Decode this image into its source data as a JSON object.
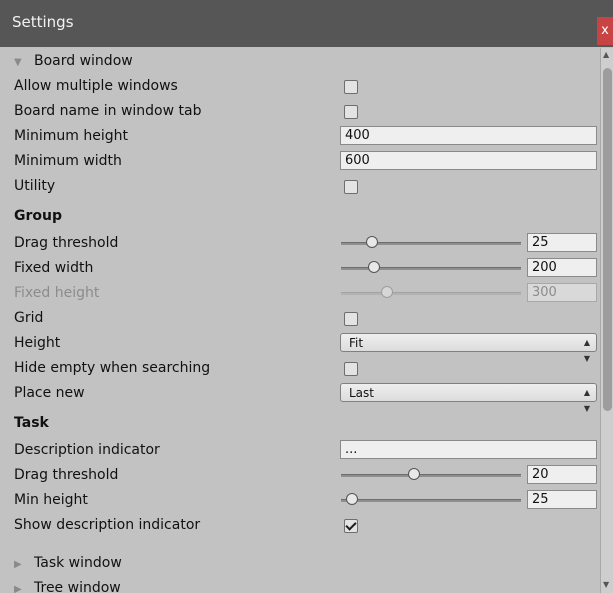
{
  "window": {
    "title": "Settings",
    "close_label": "x"
  },
  "board_window": {
    "label": "Board window",
    "allow_multiple_windows": {
      "label": "Allow multiple windows",
      "checked": false
    },
    "board_name_in_tab": {
      "label": "Board name in window tab",
      "checked": false
    },
    "minimum_height": {
      "label": "Minimum height",
      "value": "400"
    },
    "minimum_width": {
      "label": "Minimum width",
      "value": "600"
    },
    "utility": {
      "label": "Utility",
      "checked": false
    }
  },
  "group": {
    "header": "Group",
    "drag_threshold": {
      "label": "Drag threshold",
      "value": "25",
      "position": 0.15
    },
    "fixed_width": {
      "label": "Fixed width",
      "value": "200",
      "position": 0.16
    },
    "fixed_height": {
      "label": "Fixed height",
      "value": "300",
      "position": 0.24
    },
    "grid": {
      "label": "Grid",
      "checked": false
    },
    "height": {
      "label": "Height",
      "value": "Fit"
    },
    "hide_empty": {
      "label": "Hide empty when searching",
      "checked": false
    },
    "place_new": {
      "label": "Place new",
      "value": "Last"
    }
  },
  "task": {
    "header": "Task",
    "description_indicator": {
      "label": "Description indicator",
      "value": "..."
    },
    "drag_threshold": {
      "label": "Drag threshold",
      "value": "20",
      "position": 0.4
    },
    "min_height": {
      "label": "Min height",
      "value": "25",
      "position": 0.03
    },
    "show_description_indicator": {
      "label": "Show description indicator",
      "checked": true
    }
  },
  "collapsed_sections": {
    "task_window": "Task window",
    "tree_window": "Tree window"
  },
  "icons": {
    "foldout_open": "triangle-down-icon",
    "foldout_closed": "triangle-right-icon",
    "dropdown": "up-down-arrows-icon",
    "checkmark": "checkmark-icon",
    "close": "close-icon"
  },
  "colors": {
    "titlebar": "#565656",
    "panel": "#c2c2c2",
    "close": "#c84444"
  }
}
